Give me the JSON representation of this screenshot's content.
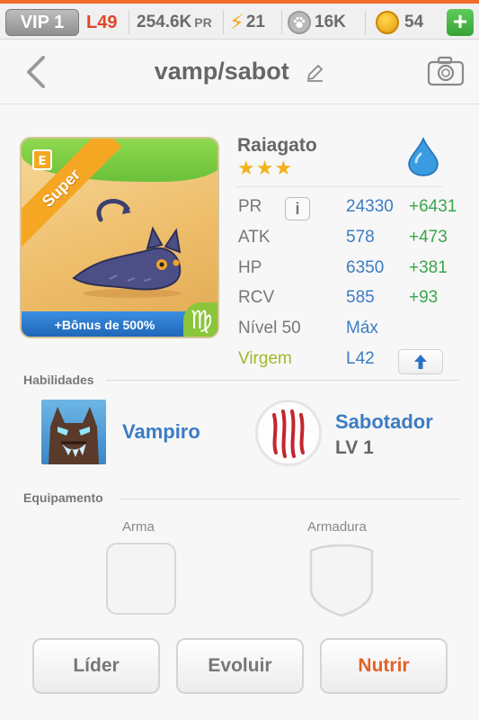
{
  "status_bar": {
    "vip": "VIP 1",
    "level": "L49",
    "pr_value": "254.6K",
    "pr_unit": "PR",
    "energy": "21",
    "paws": "16K",
    "coins": "54",
    "add_label": "+"
  },
  "nav": {
    "title": "vamp/sabot"
  },
  "card": {
    "ribbon": "Super",
    "bonus": "+Bônus de 500%",
    "zodiac_symbol": "♍"
  },
  "pet": {
    "name": "Raiagato",
    "stars": "★★★",
    "element": "water-drop-icon"
  },
  "stats": {
    "pr_label": "PR",
    "info_label": "i",
    "pr_value": "24330",
    "pr_bonus": "+6431",
    "atk_label": "ATK",
    "atk_value": "578",
    "atk_bonus": "+473",
    "hp_label": "HP",
    "hp_value": "6350",
    "hp_bonus": "+381",
    "rcv_label": "RCV",
    "rcv_value": "585",
    "rcv_bonus": "+93",
    "level_label": "Nível 50",
    "level_value": "Máx",
    "sign_label": "Virgem",
    "sign_value": "L42"
  },
  "abilities": {
    "section_label": "Habilidades",
    "first_name": "Vampiro",
    "second_name": "Sabotador",
    "second_level": "LV 1"
  },
  "equipment": {
    "section_label": "Equipamento",
    "weapon_label": "Arma",
    "armor_label": "Armadura"
  },
  "buttons": {
    "lider": "Líder",
    "evoluir": "Evoluir",
    "nutrir": "Nutrir"
  },
  "colors": {
    "accent_orange": "#e0632a",
    "value_blue": "#3c7cc4",
    "bonus_green": "#3aa64a",
    "virgo_green": "#9fb72d"
  }
}
